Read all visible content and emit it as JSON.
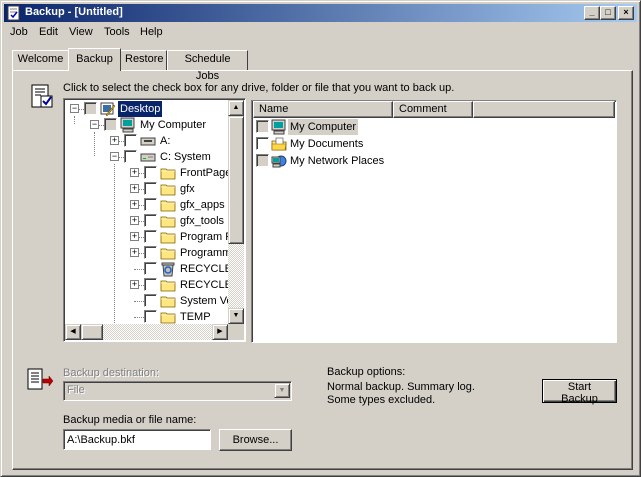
{
  "window": {
    "title": "Backup - [Untitled]",
    "minimize": "_",
    "maximize": "□",
    "close": "×"
  },
  "menu": [
    "Job",
    "Edit",
    "View",
    "Tools",
    "Help"
  ],
  "tabs": [
    "Welcome",
    "Backup",
    "Restore",
    "Schedule Jobs"
  ],
  "active_tab": "Backup",
  "instructions": "Click to select the check box for any drive, folder or file that you want to back up.",
  "tree": [
    {
      "label": "Desktop",
      "level": 0,
      "expander": "−",
      "checkbox": "gray",
      "icon": "desktop-icon",
      "selected": true
    },
    {
      "label": "My Computer",
      "level": 1,
      "expander": "−",
      "checkbox": "gray",
      "icon": "my-computer-icon"
    },
    {
      "label": "A:",
      "level": 2,
      "expander": "+",
      "checkbox": "empty",
      "icon": "floppy-drive-icon"
    },
    {
      "label": "C: System",
      "level": 2,
      "expander": "−",
      "checkbox": "empty",
      "icon": "hard-drive-icon"
    },
    {
      "label": "FrontPage",
      "level": 3,
      "expander": "+",
      "checkbox": "empty",
      "icon": "folder-icon"
    },
    {
      "label": "gfx",
      "level": 3,
      "expander": "+",
      "checkbox": "empty",
      "icon": "folder-icon"
    },
    {
      "label": "gfx_apps",
      "level": 3,
      "expander": "+",
      "checkbox": "empty",
      "icon": "folder-icon"
    },
    {
      "label": "gfx_tools",
      "level": 3,
      "expander": "+",
      "checkbox": "empty",
      "icon": "folder-icon"
    },
    {
      "label": "Program Fi",
      "level": 3,
      "expander": "+",
      "checkbox": "empty",
      "icon": "folder-icon"
    },
    {
      "label": "Programme",
      "level": 3,
      "expander": "+",
      "checkbox": "empty",
      "icon": "folder-icon"
    },
    {
      "label": "RECYCLEI",
      "level": 3,
      "expander": "",
      "checkbox": "empty",
      "icon": "recycle-bin-icon"
    },
    {
      "label": "RECYCLEI",
      "level": 3,
      "expander": "+",
      "checkbox": "empty",
      "icon": "folder-icon"
    },
    {
      "label": "System Vo",
      "level": 3,
      "expander": "",
      "checkbox": "empty",
      "icon": "folder-icon"
    },
    {
      "label": "TEMP",
      "level": 3,
      "expander": "",
      "checkbox": "empty",
      "icon": "folder-icon"
    }
  ],
  "list": {
    "columns": [
      "Name",
      "Comment"
    ],
    "items": [
      {
        "name": "My Computer",
        "icon": "my-computer-icon",
        "checkbox": "gray",
        "highlight": true
      },
      {
        "name": "My Documents",
        "icon": "my-documents-icon",
        "checkbox": "empty"
      },
      {
        "name": "My Network Places",
        "icon": "network-places-icon",
        "checkbox": "gray"
      }
    ]
  },
  "destination": {
    "label": "Backup destination:",
    "value": "File"
  },
  "media": {
    "label": "Backup media or file name:",
    "value": "A:\\Backup.bkf"
  },
  "browse_button": "Browse...",
  "options": {
    "label": "Backup options:",
    "line1": "Normal backup.  Summary log.",
    "line2": "Some types excluded."
  },
  "start_button": "Start Backup",
  "colors": {
    "face": "#d4d0c8",
    "title_start": "#0a246a",
    "title_end": "#a6caf0",
    "selection": "#0a246a"
  }
}
